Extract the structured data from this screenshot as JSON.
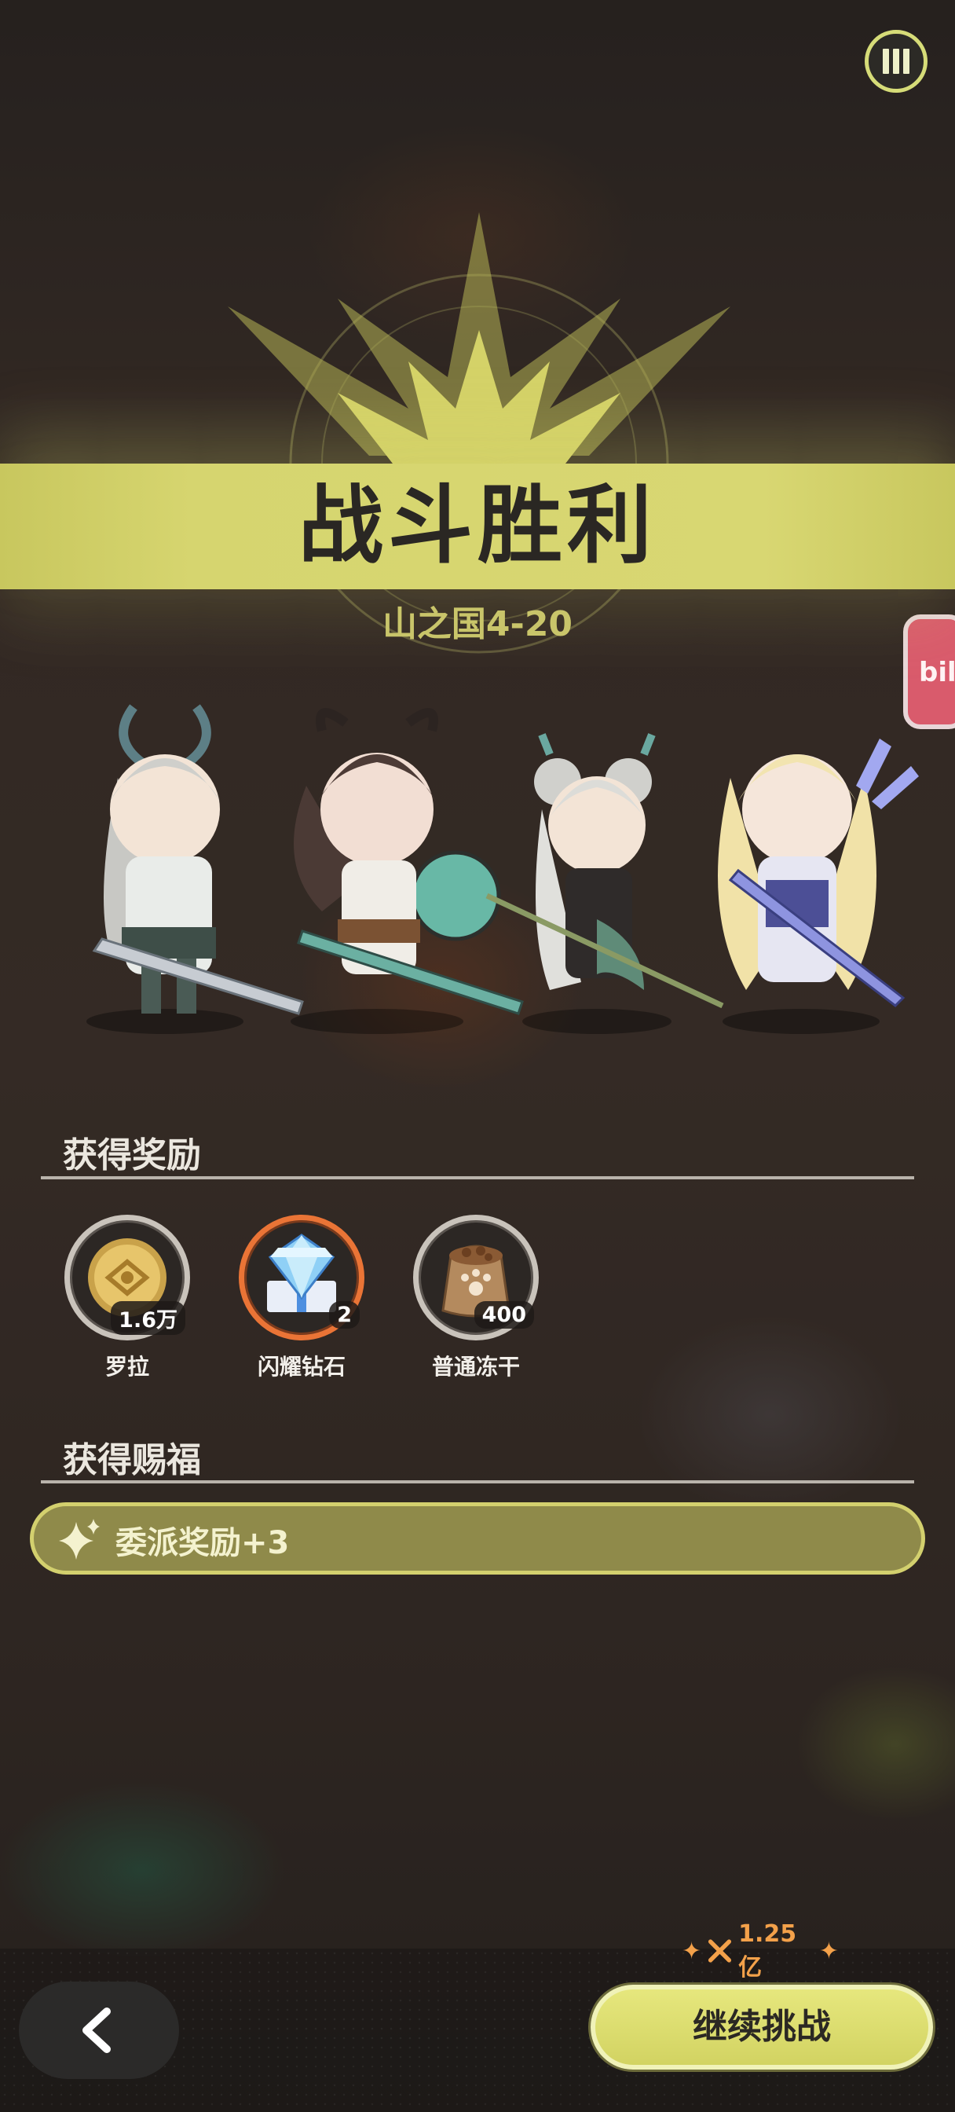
{
  "header": {
    "title": "战斗胜利",
    "stage": "山之国4-20",
    "side_tab_text": "bil"
  },
  "rewards_section": {
    "title": "获得奖励",
    "items": [
      {
        "name": "罗拉",
        "count": "1.6万",
        "icon": "gold-coin-icon"
      },
      {
        "name": "闪耀钻石",
        "count": "2",
        "icon": "diamond-icon"
      },
      {
        "name": "普通冻干",
        "count": "400",
        "icon": "food-bag-icon"
      }
    ]
  },
  "blessing_section": {
    "title": "获得赐福",
    "items": [
      {
        "text": "委派奖励+3",
        "icon": "sparkle-icon"
      }
    ]
  },
  "footer": {
    "power": "1.25亿",
    "continue_label": "继续挑战"
  },
  "colors": {
    "accent": "#d6d56f",
    "orange": "#ea7436"
  }
}
